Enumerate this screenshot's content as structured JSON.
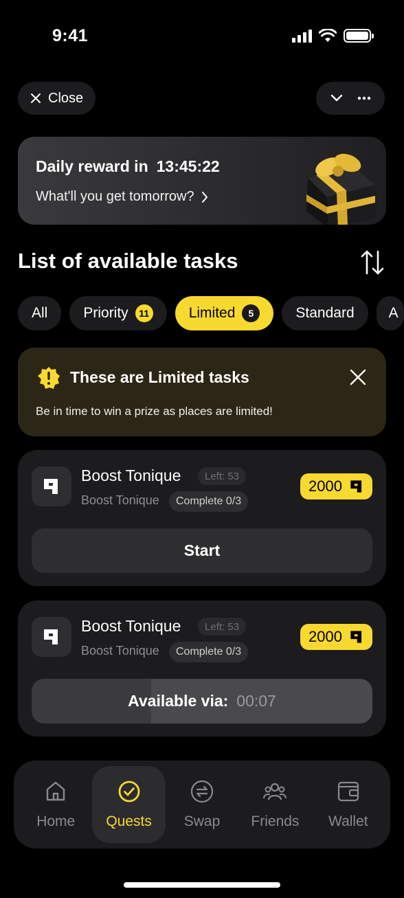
{
  "status_bar": {
    "time": "9:41"
  },
  "top_bar": {
    "close_label": "Close"
  },
  "daily_reward": {
    "title": "Daily reward in",
    "countdown": "13:45:22",
    "subtitle": "What'll you get tomorrow?"
  },
  "section": {
    "title": "List of available tasks"
  },
  "tabs": [
    {
      "label": "All"
    },
    {
      "label": "Priority",
      "badge": "11"
    },
    {
      "label": "Limited",
      "badge": "5",
      "active": true
    },
    {
      "label": "Standard"
    },
    {
      "label": "A"
    }
  ],
  "info_card": {
    "title": "These are Limited tasks",
    "text": "Be in time to win a prize as places are limited!"
  },
  "tasks": [
    {
      "name": "Boost Tonique",
      "left": "Left: 53",
      "subtitle": "Boost Tonique",
      "progress": "Complete 0/3",
      "reward": "2000",
      "button_label": "Start"
    },
    {
      "name": "Boost Tonique",
      "left": "Left: 53",
      "subtitle": "Boost Tonique",
      "progress": "Complete 0/3",
      "reward": "2000",
      "button_label": "Available via:",
      "button_timer": "00:07",
      "button_progress": 0.35
    }
  ],
  "nav": [
    {
      "label": "Home",
      "icon": "home-icon"
    },
    {
      "label": "Quests",
      "icon": "check-circle-icon",
      "active": true
    },
    {
      "label": "Swap",
      "icon": "swap-icon"
    },
    {
      "label": "Friends",
      "icon": "friends-icon"
    },
    {
      "label": "Wallet",
      "icon": "wallet-icon"
    }
  ],
  "colors": {
    "accent": "#f8d92f",
    "background": "#000000",
    "card": "#1c1c1e",
    "warning_card": "#2c2616"
  }
}
